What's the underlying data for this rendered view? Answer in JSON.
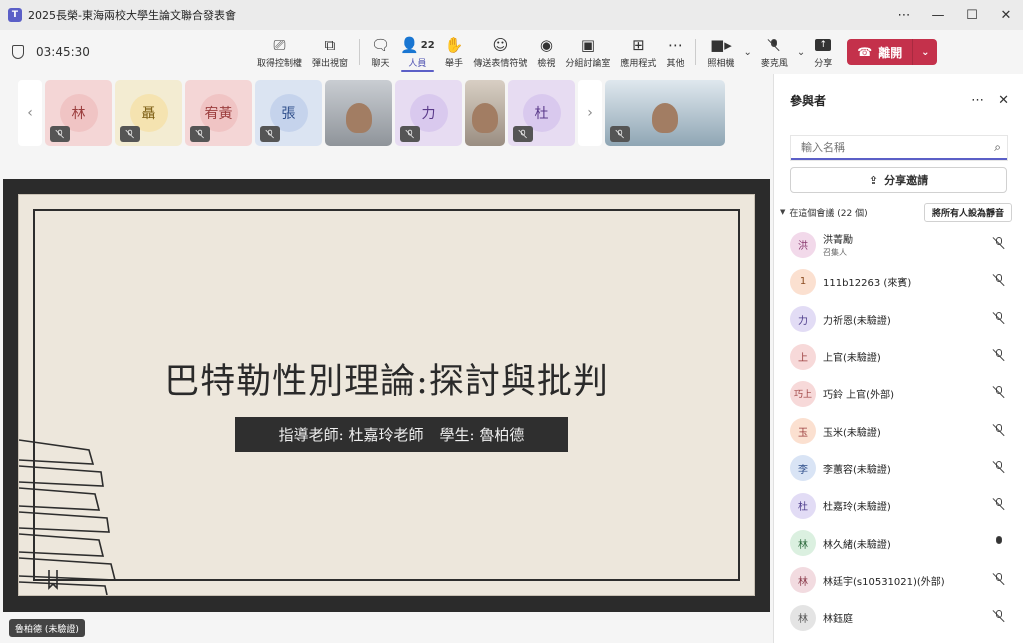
{
  "window": {
    "title": "2025長榮-東海兩校大學生論文聯合發表會",
    "controls": [
      "⋯",
      "—",
      "☐",
      "✕"
    ]
  },
  "toolbar": {
    "timer": "03:45:30",
    "buttons": [
      {
        "label": "取得控制權",
        "icon": "take-control-icon",
        "glyph": "⎚"
      },
      {
        "label": "彈出視窗",
        "icon": "popout-icon",
        "glyph": "⧉"
      },
      {
        "label": "聊天",
        "icon": "chat-icon",
        "glyph": "🗨"
      },
      {
        "label": "人員",
        "icon": "people-icon",
        "glyph": "👤",
        "badge": "22",
        "active": true
      },
      {
        "label": "舉手",
        "icon": "raise-hand-icon",
        "glyph": "✋"
      },
      {
        "label": "傳送表情符號",
        "icon": "emoji-icon",
        "glyph": "☺"
      },
      {
        "label": "檢視",
        "icon": "view-icon",
        "glyph": "◉"
      },
      {
        "label": "分組討論室",
        "icon": "breakout-rooms-icon",
        "glyph": "▣"
      },
      {
        "label": "應用程式",
        "icon": "apps-icon",
        "glyph": "⊞"
      },
      {
        "label": "其他",
        "icon": "more-icon",
        "glyph": "⋯"
      }
    ],
    "camera_label": "照相機",
    "mic_label": "麥克風",
    "share_label": "分享",
    "leave_label": "離開"
  },
  "gallery": {
    "tiles": [
      {
        "initials": "林",
        "bg": "#f4d6d6",
        "avbg": "#f0c4c4",
        "fg": "#9b3d3d",
        "muted": true
      },
      {
        "initials": "聶",
        "bg": "#f3ecd2",
        "avbg": "#f5e3b0",
        "fg": "#7c5d12",
        "muted": true
      },
      {
        "initials": "宥黃",
        "bg": "#f4d6d6",
        "avbg": "#f0c4c4",
        "fg": "#9b3d3d",
        "muted": true
      },
      {
        "initials": "張",
        "bg": "#dbe4f2",
        "avbg": "#c5d3ec",
        "fg": "#2d4d8a",
        "muted": true
      },
      {
        "video": true,
        "muted": false
      },
      {
        "initials": "力",
        "bg": "#e7dcf2",
        "avbg": "#d9c9ee",
        "fg": "#5a3a8a",
        "muted": true
      },
      {
        "video": true,
        "muted": false
      },
      {
        "initials": "杜",
        "bg": "#e7dcf2",
        "avbg": "#d9c9ee",
        "fg": "#5a3a8a",
        "muted": true
      },
      {
        "video": true,
        "muted": true
      }
    ]
  },
  "slide": {
    "title": "巴特勒性別理論:探討與批判",
    "advisor": "指導老師: 杜嘉玲老師",
    "student": "學生: 魯柏德"
  },
  "presenter_label": "魯柏德 (未驗證)",
  "panel": {
    "title": "參與者",
    "search_placeholder": "輸入名稱",
    "invite_label": "分享邀請",
    "section_label": "在這個會議 (22 個)",
    "mute_all_label": "將所有人設為靜音",
    "participants": [
      {
        "initials": "洪",
        "name": "洪菁勵",
        "role": "召集人",
        "avbg": "#f2d9ea",
        "fg": "#8a3a6f",
        "mic": "muted"
      },
      {
        "initials": "1",
        "name": "111b12263 (來賓)",
        "role": "",
        "avbg": "#fbe0d0",
        "fg": "#8a4a1f",
        "mic": "muted"
      },
      {
        "initials": "力",
        "name": "力祈恩(未驗證)",
        "role": "",
        "avbg": "#e2dcf5",
        "fg": "#4b3a8a",
        "mic": "muted"
      },
      {
        "initials": "上",
        "name": "上官(未驗證)",
        "role": "",
        "avbg": "#f7d9d9",
        "fg": "#9b3d3d",
        "mic": "muted"
      },
      {
        "initials": "巧上",
        "name": "巧鈴 上官(外部)",
        "role": "",
        "avbg": "#f7d9d9",
        "fg": "#9b3d3d",
        "mic": "muted"
      },
      {
        "initials": "玉",
        "name": "玉米(未驗證)",
        "role": "",
        "avbg": "#fbe0d0",
        "fg": "#9b3d3d",
        "mic": "muted"
      },
      {
        "initials": "李",
        "name": "李蕙容(未驗證)",
        "role": "",
        "avbg": "#d9e4f5",
        "fg": "#2d4d8a",
        "mic": "muted"
      },
      {
        "initials": "杜",
        "name": "杜嘉玲(未驗證)",
        "role": "",
        "avbg": "#e2dcf5",
        "fg": "#4b3a8a",
        "mic": "muted"
      },
      {
        "initials": "林",
        "name": "林久緒(未驗證)",
        "role": "",
        "avbg": "#dbf0e0",
        "fg": "#2d6a3d",
        "mic": "live"
      },
      {
        "initials": "林",
        "name": "林廷宇(s10531021)(外部)",
        "role": "",
        "avbg": "#f2dbe0",
        "fg": "#8a3a4a",
        "mic": "muted"
      },
      {
        "initials": "林",
        "name": "林鈺庭",
        "role": "",
        "avbg": "#e4e4e4",
        "fg": "#555",
        "mic": "muted"
      }
    ]
  }
}
